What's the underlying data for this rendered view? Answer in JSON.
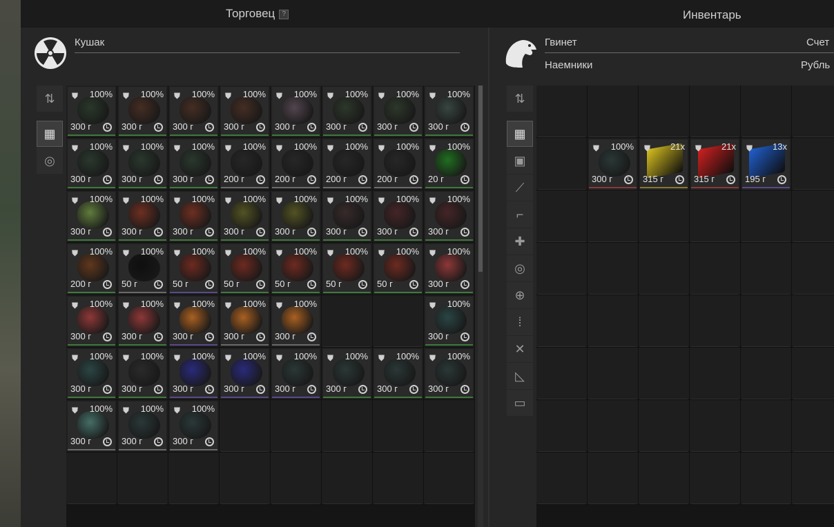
{
  "trader": {
    "header": "Торговец",
    "help": "?",
    "name": "Кушак",
    "icon": "radiation-icon",
    "sort_icon": "sort-icon",
    "grid_icon": "grid-icon",
    "artifact_icon": "artifact-icon"
  },
  "inventory": {
    "header": "Инвентарь",
    "player": "Гвинет",
    "faction": "Наемники",
    "account_label": "Счет",
    "currency_label": "Рубль",
    "icon": "eagle-icon",
    "categories": [
      "sort-icon",
      "grid-icon",
      "armor-icon",
      "rifle-icon",
      "pistol-icon",
      "grenade-icon",
      "artifact-icon",
      "medkit-icon",
      "ammo-icon",
      "tools-icon",
      "ruler-icon",
      "box-icon"
    ]
  },
  "trader_items": [
    {
      "pct": "100%",
      "price": "300 г",
      "color": "#2a3a2a",
      "border": "g"
    },
    {
      "pct": "100%",
      "price": "300 г",
      "color": "#4a2e22",
      "border": "g"
    },
    {
      "pct": "100%",
      "price": "300 г",
      "color": "#4a2e22",
      "border": "g"
    },
    {
      "pct": "100%",
      "price": "300 г",
      "color": "#4a2e22",
      "border": "g"
    },
    {
      "pct": "100%",
      "price": "300 г",
      "color": "#5a4a55",
      "border": "g"
    },
    {
      "pct": "100%",
      "price": "300 г",
      "color": "#2e3a2a",
      "border": "g"
    },
    {
      "pct": "100%",
      "price": "300 г",
      "color": "#2e3a2a",
      "border": "g"
    },
    {
      "pct": "100%",
      "price": "300 г",
      "color": "#3a4a44",
      "border": "g"
    },
    {
      "pct": "100%",
      "price": "300 г",
      "color": "#2a3a2e",
      "border": "g"
    },
    {
      "pct": "100%",
      "price": "300 г",
      "color": "#2a3a2e",
      "border": "g"
    },
    {
      "pct": "100%",
      "price": "300 г",
      "color": "#2a3a2e",
      "border": "g"
    },
    {
      "pct": "100%",
      "price": "200 г",
      "color": "#262626",
      "border": "w"
    },
    {
      "pct": "100%",
      "price": "200 г",
      "color": "#262626",
      "border": "w"
    },
    {
      "pct": "100%",
      "price": "200 г",
      "color": "#262626",
      "border": "w"
    },
    {
      "pct": "100%",
      "price": "200 г",
      "color": "#262626",
      "border": "w"
    },
    {
      "pct": "100%",
      "price": "20 г",
      "color": "#1f7a1f",
      "border": "g"
    },
    {
      "pct": "100%",
      "price": "300 г",
      "color": "#6a8a40",
      "border": "g"
    },
    {
      "pct": "100%",
      "price": "300 г",
      "color": "#7a3020",
      "border": "g"
    },
    {
      "pct": "100%",
      "price": "300 г",
      "color": "#7a3020",
      "border": "g"
    },
    {
      "pct": "100%",
      "price": "300 г",
      "color": "#5a5a22",
      "border": "g"
    },
    {
      "pct": "100%",
      "price": "300 г",
      "color": "#5a5a22",
      "border": "g"
    },
    {
      "pct": "100%",
      "price": "300 г",
      "color": "#3a2a2a",
      "border": "g"
    },
    {
      "pct": "100%",
      "price": "300 г",
      "color": "#4a2426",
      "border": "g"
    },
    {
      "pct": "100%",
      "price": "300 г",
      "color": "#4a2426",
      "border": "g"
    },
    {
      "pct": "100%",
      "price": "200 г",
      "color": "#6a3a1a",
      "border": "g"
    },
    {
      "pct": "100%",
      "price": "50 г",
      "color": "#0a0a0a",
      "border": "w"
    },
    {
      "pct": "100%",
      "price": "50 г",
      "color": "#7a2a1e",
      "border": "p"
    },
    {
      "pct": "100%",
      "price": "50 г",
      "color": "#7a2a1e",
      "border": "g"
    },
    {
      "pct": "100%",
      "price": "50 г",
      "color": "#7a2a1e",
      "border": "g"
    },
    {
      "pct": "100%",
      "price": "50 г",
      "color": "#7a2a1e",
      "border": "g"
    },
    {
      "pct": "100%",
      "price": "50 г",
      "color": "#7a2a1e",
      "border": "g"
    },
    {
      "pct": "100%",
      "price": "300 г",
      "color": "#a03a3a",
      "border": "g"
    },
    {
      "pct": "100%",
      "price": "300 г",
      "color": "#a03a3a",
      "border": "g"
    },
    {
      "pct": "100%",
      "price": "300 г",
      "color": "#a03a3a",
      "border": "g"
    },
    {
      "pct": "100%",
      "price": "300 г",
      "color": "#c06a20",
      "border": "p"
    },
    {
      "pct": "100%",
      "price": "300 г",
      "color": "#c06a20",
      "border": "w"
    },
    {
      "pct": "100%",
      "price": "300 г",
      "color": "#c06a20",
      "border": "w"
    },
    null,
    null,
    {
      "pct": "100%",
      "price": "300 г",
      "color": "#2a4a48",
      "border": "g"
    },
    {
      "pct": "100%",
      "price": "300 г",
      "color": "#2a4a48",
      "border": "g"
    },
    {
      "pct": "100%",
      "price": "300 г",
      "color": "#2a2a2a",
      "border": "g"
    },
    {
      "pct": "100%",
      "price": "300 г",
      "color": "#2a2a8a",
      "border": "p"
    },
    {
      "pct": "100%",
      "price": "300 г",
      "color": "#2a2a8a",
      "border": "p"
    },
    {
      "pct": "100%",
      "price": "300 г",
      "color": "#2a3a38",
      "border": "p"
    },
    {
      "pct": "100%",
      "price": "300 г",
      "color": "#2a3a38",
      "border": "g"
    },
    {
      "pct": "100%",
      "price": "300 г",
      "color": "#2a3a38",
      "border": "g"
    },
    {
      "pct": "100%",
      "price": "300 г",
      "color": "#2a3a38",
      "border": "g"
    },
    {
      "pct": "100%",
      "price": "300 г",
      "color": "#4a7a70",
      "border": "w"
    },
    {
      "pct": "100%",
      "price": "300 г",
      "color": "#2a3a3a",
      "border": "w"
    },
    {
      "pct": "100%",
      "price": "300 г",
      "color": "#2a3a3a",
      "border": "w"
    }
  ],
  "inventory_items": [
    {
      "pct": "100%",
      "price": "300 г",
      "color": "#2a3a38",
      "border": "r"
    },
    {
      "pct": "21x",
      "price": "315 г",
      "color": "#d8c020",
      "border": "y"
    },
    {
      "pct": "21x",
      "price": "315 г",
      "color": "#d02020",
      "border": "r"
    },
    {
      "pct": "13x",
      "price": "195 г",
      "color": "#2060d0",
      "border": "p"
    }
  ]
}
